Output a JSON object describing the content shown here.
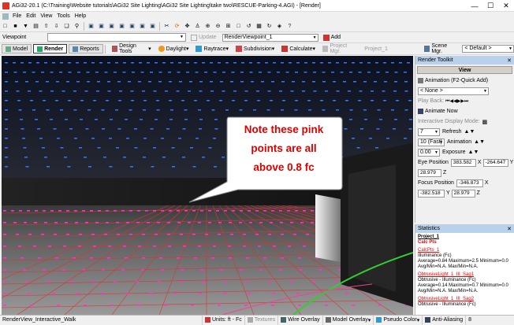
{
  "window": {
    "title": "AGi32-20.1 (C:\\Training\\Website tutorials\\AGi32 Site Lighting\\AGi32 Site Lighting\\take two\\RESCUE-Parking-4.AGI) - [Render]"
  },
  "menu": [
    "File",
    "Edit",
    "View",
    "Tools",
    "Help"
  ],
  "toolbar2": {
    "viewpoint_label": "Viewpoint",
    "update_label": "Update",
    "viewpoint_value": "RenderViewpoint_1",
    "add_label": "Add"
  },
  "toolbar3": {
    "tabs": [
      "Model",
      "Render",
      "Reports"
    ],
    "design_tools": "Design Tools",
    "daylight": "Daylight",
    "raytrace": "Raytrace",
    "subdivision": "Subdivision",
    "calculate": "Calculate",
    "project_mgr": "Project Mgr.",
    "project_value": "Project_1",
    "scene_mgr": "Scene Mgr.",
    "scene_value": "< Default >"
  },
  "callout": {
    "line1": "Note these pink",
    "line2": "points are all",
    "line3": "above 0.8 fc"
  },
  "toolkit": {
    "title": "Render Toolkit",
    "view_header": "View",
    "animation_label": "Animation (F2-Quick Add)",
    "animation_value": "< None >",
    "play_back": "Play Back:",
    "animate_now": "Animate Now",
    "interactive_mode": "Interactive Display Mode:",
    "refresh_value": "7",
    "refresh_label": "Refresh",
    "animation_speed": "10 (Fast)",
    "animation_label2": "Animation",
    "exposure_value": "0.00",
    "exposure_label": "Exposure",
    "eye_label": "Eye Position",
    "eye_x": "383.582",
    "eye_x_axis": "X",
    "eye_y": "-264.647",
    "eye_y_axis": "Y",
    "eye_z": "28.979",
    "eye_z_axis": "Z",
    "focus_label": "Focus Position",
    "focus_x": "-346.873",
    "focus_x_axis": "X",
    "focus_y": "-382.518",
    "focus_y_axis": "Y",
    "focus_z": "28.979",
    "focus_z_axis": "Z"
  },
  "statistics": {
    "title": "Statistics",
    "project": "Project_1",
    "calc_pts": "Calc Pts",
    "blocks": [
      {
        "name": "CalcPts_1",
        "l1": "Illuminance (Fc)",
        "l2": "Average=0.84   Maximum=2.5   Minimum=0.0",
        "l3": "Avg/Min=N.A.   Max/Min=N.A."
      },
      {
        "name": "ObtrusiveLight_1_III_Sag1",
        "l1": "Obtrusive - Illuminance (Fc)",
        "l2": "Average=0.14   Maximum=0.7   Minimum=0.0",
        "l3": "Avg/Min=N.A.   Max/Min=N.A."
      },
      {
        "name": "ObtrusiveLight_1_III_Sag2",
        "l1": "Obtrusive - Illuminance (Fc)",
        "l2": "",
        "l3": ""
      }
    ]
  },
  "statusbar": {
    "view_name": "RenderView_Interactive_Walk",
    "units": "Units: ft - Fc",
    "textures": "Textures",
    "wire_overlay": "Wire Overlay",
    "model_overlay": "Model Overlay",
    "pseudo_color": "Pseudo Color",
    "anti_aliasing": "Anti-Aliasing",
    "aa_value": "8"
  },
  "colors": {
    "panel_header": "#b9d1ea",
    "callout_text": "#dd0000",
    "pink_points": "#ff33cc",
    "blue_points": "#3377ff"
  }
}
